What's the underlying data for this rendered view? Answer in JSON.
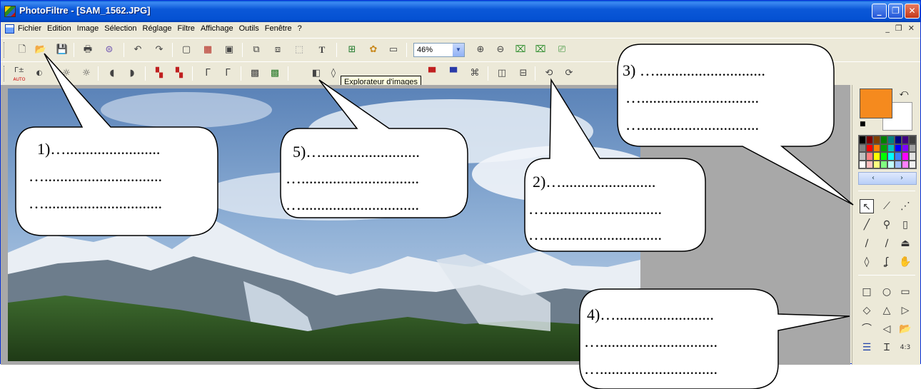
{
  "window": {
    "title": "PhotoFiltre - [SAM_1562.JPG]",
    "minimize_label": "_",
    "maximize_label": "❐",
    "close_label": "✕"
  },
  "menubar": {
    "items": [
      "Fichier",
      "Edition",
      "Image",
      "Sélection",
      "Réglage",
      "Filtre",
      "Affichage",
      "Outils",
      "Fenêtre",
      "?"
    ],
    "mdi": [
      "_",
      "❐",
      "✕"
    ]
  },
  "toolbar": {
    "zoom_value": "46%",
    "text_tool_glyph": "T"
  },
  "toolbar2": {
    "gamma_minus_label": "Γ±",
    "gamma_auto_label": "AUTO"
  },
  "tooltip": {
    "text": "Explorateur d'images"
  },
  "colors": {
    "foreground": "#f58a1e",
    "background": "#ffffff",
    "titlebar": "#0451d2"
  },
  "palette": [
    "#000000",
    "#800000",
    "#804000",
    "#008000",
    "#008080",
    "#000080",
    "#400080",
    "#404040",
    "#808080",
    "#ff0000",
    "#ff8000",
    "#00a000",
    "#00c0c0",
    "#0000ff",
    "#8000ff",
    "#a0a0a0",
    "#c0c0c0",
    "#ff8080",
    "#ffff00",
    "#00ff00",
    "#00ffff",
    "#4080ff",
    "#ff00ff",
    "#e0e0e0",
    "#ffffff",
    "#ffc0c0",
    "#ffff80",
    "#80ff80",
    "#c0ffff",
    "#a0c0ff",
    "#ff80ff",
    "#f0f0f0"
  ],
  "palette_nav": {
    "prev": "‹",
    "next": "›"
  },
  "callouts": {
    "c1": [
      "1)…........................",
      "…..............................",
      "….............................."
    ],
    "c2": [
      "2)…........................",
      "…..............................",
      "….............................."
    ],
    "c3": [
      "3) …............................",
      "…..............................",
      "….............................."
    ],
    "c4": [
      "4)….........................",
      "…..............................",
      "….............................."
    ],
    "c5": [
      "5)….........................",
      "…..............................",
      "….............................."
    ]
  }
}
